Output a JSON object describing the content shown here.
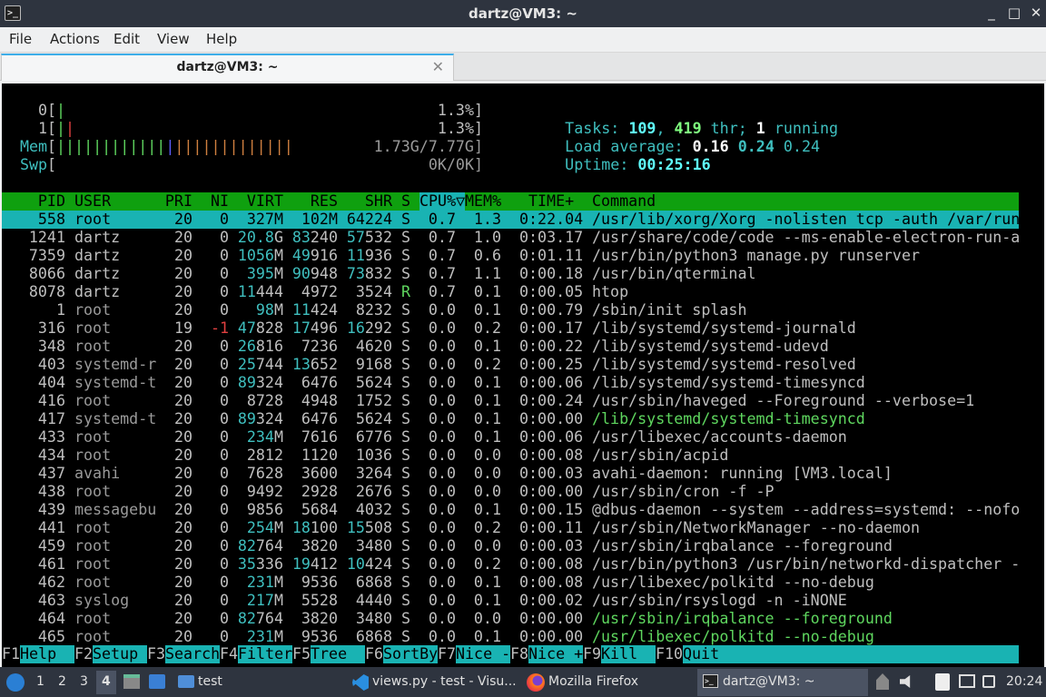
{
  "window": {
    "title": "dartz@VM3: ~",
    "controls": {
      "minimize": "_",
      "maximize": "□",
      "close": "✕"
    }
  },
  "menu": [
    "File",
    "Actions",
    "Edit",
    "View",
    "Help"
  ],
  "tab": {
    "label": "dartz@VM3: ~",
    "close": "✕"
  },
  "htop": {
    "cpu0": {
      "label": "0[",
      "pct": "1.3%]"
    },
    "cpu1": {
      "label": "1[",
      "pct": "1.3%]"
    },
    "mem": {
      "label": "Mem[",
      "bars": "||||||||||||||||||||||||||",
      "value": "1.73G/7.77G]"
    },
    "swp": {
      "label": "Swp[",
      "value": "0K/0K]"
    },
    "tasks": {
      "label": "Tasks: ",
      "count": "109",
      "sep": ", ",
      "thr": "419",
      "thr_label": " thr; ",
      "running": "1",
      "running_label": " running"
    },
    "load": {
      "label": "Load average: ",
      "l1": "0.16",
      "l5": "0.24",
      "l15": "0.24"
    },
    "uptime": {
      "label": "Uptime: ",
      "value": "00:25:16"
    },
    "columns": {
      "pid": "PID",
      "user": "USER",
      "pri": "PRI",
      "ni": "NI",
      "virt": "VIRT",
      "res": "RES",
      "shr": "SHR",
      "s": "S",
      "cpu": "CPU%▽",
      "mem": "MEM%",
      "time": "TIME+",
      "command": "Command"
    },
    "processes": [
      {
        "pid": "558",
        "user": "root",
        "pri": "20",
        "ni": "0",
        "virt": "327M",
        "res": "102M",
        "shr": "64224",
        "s": "S",
        "cpu": "0.7",
        "mem": "1.3",
        "time": "0:22.04",
        "command": "/usr/lib/xorg/Xorg -nolisten tcp -auth /var/run"
      },
      {
        "pid": "1241",
        "user": "dartz",
        "pri": "20",
        "ni": "0",
        "virt": "20.8G",
        "res": "83240",
        "shr": "57532",
        "s": "S",
        "cpu": "0.7",
        "mem": "1.0",
        "time": "0:03.17",
        "command": "/usr/share/code/code --ms-enable-electron-run-a"
      },
      {
        "pid": "7359",
        "user": "dartz",
        "pri": "20",
        "ni": "0",
        "virt": "1056M",
        "res": "49916",
        "shr": "11936",
        "s": "S",
        "cpu": "0.7",
        "mem": "0.6",
        "time": "0:01.11",
        "command": "/usr/bin/python3 manage.py runserver"
      },
      {
        "pid": "8066",
        "user": "dartz",
        "pri": "20",
        "ni": "0",
        "virt": "395M",
        "res": "90948",
        "shr": "73832",
        "s": "S",
        "cpu": "0.7",
        "mem": "1.1",
        "time": "0:00.18",
        "command": "/usr/bin/qterminal"
      },
      {
        "pid": "8078",
        "user": "dartz",
        "pri": "20",
        "ni": "0",
        "virt": "11444",
        "res": "4972",
        "shr": "3524",
        "s": "R",
        "cpu": "0.7",
        "mem": "0.1",
        "time": "0:00.05",
        "command": "htop"
      },
      {
        "pid": "1",
        "user": "root",
        "pri": "20",
        "ni": "0",
        "virt": "98M",
        "res": "11424",
        "shr": "8232",
        "s": "S",
        "cpu": "0.0",
        "mem": "0.1",
        "time": "0:00.79",
        "command": "/sbin/init splash"
      },
      {
        "pid": "316",
        "user": "root",
        "pri": "19",
        "ni": "-1",
        "virt": "47828",
        "res": "17496",
        "shr": "16292",
        "s": "S",
        "cpu": "0.0",
        "mem": "0.2",
        "time": "0:00.17",
        "command": "/lib/systemd/systemd-journald"
      },
      {
        "pid": "348",
        "user": "root",
        "pri": "20",
        "ni": "0",
        "virt": "26816",
        "res": "7236",
        "shr": "4620",
        "s": "S",
        "cpu": "0.0",
        "mem": "0.1",
        "time": "0:00.22",
        "command": "/lib/systemd/systemd-udevd"
      },
      {
        "pid": "403",
        "user": "systemd-r",
        "pri": "20",
        "ni": "0",
        "virt": "25744",
        "res": "13652",
        "shr": "9168",
        "s": "S",
        "cpu": "0.0",
        "mem": "0.2",
        "time": "0:00.25",
        "command": "/lib/systemd/systemd-resolved"
      },
      {
        "pid": "404",
        "user": "systemd-t",
        "pri": "20",
        "ni": "0",
        "virt": "89324",
        "res": "6476",
        "shr": "5624",
        "s": "S",
        "cpu": "0.0",
        "mem": "0.1",
        "time": "0:00.06",
        "command": "/lib/systemd/systemd-timesyncd"
      },
      {
        "pid": "416",
        "user": "root",
        "pri": "20",
        "ni": "0",
        "virt": "8728",
        "res": "4948",
        "shr": "1752",
        "s": "S",
        "cpu": "0.0",
        "mem": "0.1",
        "time": "0:00.24",
        "command": "/usr/sbin/haveged --Foreground --verbose=1"
      },
      {
        "pid": "417",
        "user": "systemd-t",
        "pri": "20",
        "ni": "0",
        "virt": "89324",
        "res": "6476",
        "shr": "5624",
        "s": "S",
        "cpu": "0.0",
        "mem": "0.1",
        "time": "0:00.00",
        "command": "/lib/systemd/systemd-timesyncd",
        "thread": true
      },
      {
        "pid": "433",
        "user": "root",
        "pri": "20",
        "ni": "0",
        "virt": "234M",
        "res": "7616",
        "shr": "6776",
        "s": "S",
        "cpu": "0.0",
        "mem": "0.1",
        "time": "0:00.06",
        "command": "/usr/libexec/accounts-daemon"
      },
      {
        "pid": "434",
        "user": "root",
        "pri": "20",
        "ni": "0",
        "virt": "2812",
        "res": "1120",
        "shr": "1036",
        "s": "S",
        "cpu": "0.0",
        "mem": "0.0",
        "time": "0:00.08",
        "command": "/usr/sbin/acpid"
      },
      {
        "pid": "437",
        "user": "avahi",
        "pri": "20",
        "ni": "0",
        "virt": "7628",
        "res": "3600",
        "shr": "3264",
        "s": "S",
        "cpu": "0.0",
        "mem": "0.0",
        "time": "0:00.03",
        "command": "avahi-daemon: running [VM3.local]"
      },
      {
        "pid": "438",
        "user": "root",
        "pri": "20",
        "ni": "0",
        "virt": "9492",
        "res": "2928",
        "shr": "2676",
        "s": "S",
        "cpu": "0.0",
        "mem": "0.0",
        "time": "0:00.00",
        "command": "/usr/sbin/cron -f -P"
      },
      {
        "pid": "439",
        "user": "messagebu",
        "pri": "20",
        "ni": "0",
        "virt": "9856",
        "res": "5684",
        "shr": "4032",
        "s": "S",
        "cpu": "0.0",
        "mem": "0.1",
        "time": "0:00.15",
        "command": "@dbus-daemon --system --address=systemd: --nofo"
      },
      {
        "pid": "441",
        "user": "root",
        "pri": "20",
        "ni": "0",
        "virt": "254M",
        "res": "18100",
        "shr": "15508",
        "s": "S",
        "cpu": "0.0",
        "mem": "0.2",
        "time": "0:00.11",
        "command": "/usr/sbin/NetworkManager --no-daemon"
      },
      {
        "pid": "459",
        "user": "root",
        "pri": "20",
        "ni": "0",
        "virt": "82764",
        "res": "3820",
        "shr": "3480",
        "s": "S",
        "cpu": "0.0",
        "mem": "0.0",
        "time": "0:00.03",
        "command": "/usr/sbin/irqbalance --foreground"
      },
      {
        "pid": "461",
        "user": "root",
        "pri": "20",
        "ni": "0",
        "virt": "35336",
        "res": "19412",
        "shr": "10424",
        "s": "S",
        "cpu": "0.0",
        "mem": "0.2",
        "time": "0:00.08",
        "command": "/usr/bin/python3 /usr/bin/networkd-dispatcher -"
      },
      {
        "pid": "462",
        "user": "root",
        "pri": "20",
        "ni": "0",
        "virt": "231M",
        "res": "9536",
        "shr": "6868",
        "s": "S",
        "cpu": "0.0",
        "mem": "0.1",
        "time": "0:00.08",
        "command": "/usr/libexec/polkitd --no-debug"
      },
      {
        "pid": "463",
        "user": "syslog",
        "pri": "20",
        "ni": "0",
        "virt": "217M",
        "res": "5528",
        "shr": "4440",
        "s": "S",
        "cpu": "0.0",
        "mem": "0.1",
        "time": "0:00.02",
        "command": "/usr/sbin/rsyslogd -n -iNONE"
      },
      {
        "pid": "464",
        "user": "root",
        "pri": "20",
        "ni": "0",
        "virt": "82764",
        "res": "3820",
        "shr": "3480",
        "s": "S",
        "cpu": "0.0",
        "mem": "0.0",
        "time": "0:00.00",
        "command": "/usr/sbin/irqbalance --foreground",
        "thread": true
      },
      {
        "pid": "465",
        "user": "root",
        "pri": "20",
        "ni": "0",
        "virt": "231M",
        "res": "9536",
        "shr": "6868",
        "s": "S",
        "cpu": "0.0",
        "mem": "0.1",
        "time": "0:00.00",
        "command": "/usr/libexec/polkitd --no-debug",
        "thread": true
      }
    ],
    "fkeys": [
      {
        "key": "F1",
        "label": "Help  "
      },
      {
        "key": "F2",
        "label": "Setup "
      },
      {
        "key": "F3",
        "label": "Search"
      },
      {
        "key": "F4",
        "label": "Filter"
      },
      {
        "key": "F5",
        "label": "Tree  "
      },
      {
        "key": "F6",
        "label": "SortBy"
      },
      {
        "key": "F7",
        "label": "Nice -"
      },
      {
        "key": "F8",
        "label": "Nice +"
      },
      {
        "key": "F9",
        "label": "Kill  "
      },
      {
        "key": "F10",
        "label": "Quit"
      }
    ]
  },
  "taskbar": {
    "workspaces": [
      "1",
      "2",
      "3",
      "4"
    ],
    "active_workspace": "4",
    "folder_task": "test",
    "tasks": [
      {
        "label": "views.py - test - Visu...",
        "icon": "vscode-icon"
      },
      {
        "label": "Mozilla Firefox",
        "icon": "firefox-icon"
      },
      {
        "label": "dartz@VM3: ~",
        "icon": "terminal-icon"
      }
    ],
    "clock": "20:24"
  },
  "colors": {
    "header_green": "#0fa00f",
    "selection_cyan": "#19b3b3",
    "panel": "#2e343f"
  }
}
